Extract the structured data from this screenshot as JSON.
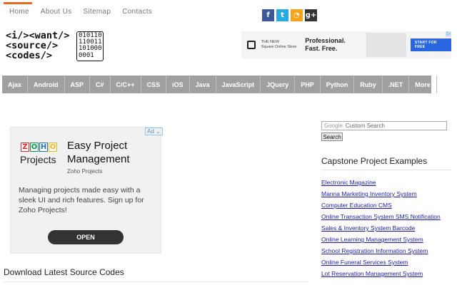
{
  "top_nav": {
    "items": [
      "Home",
      "About Us",
      "Sitemap",
      "Contacts"
    ]
  },
  "social": [
    {
      "icon": "facebook-icon",
      "glyph": "f",
      "color": "#3b5998"
    },
    {
      "icon": "twitter-icon",
      "glyph": "t",
      "color": "#29a9e1"
    },
    {
      "icon": "rss-icon",
      "glyph": "◔",
      "color": "#f7a21b"
    },
    {
      "icon": "google-plus-icon",
      "glyph": "g+",
      "color": "#333333"
    }
  ],
  "logo": {
    "line1": "<i/><want/>",
    "line2": "<source/>",
    "line3": "<codes/>",
    "binary": "010110\n110011\n101000\n0001"
  },
  "banner_ad": {
    "store": "THE NEW\nSquare Online Store",
    "slogan": "Professional.\nFast. Free.",
    "cta": "START FOR FREE"
  },
  "main_nav": {
    "items": [
      "Ajax",
      "Android",
      "ASP",
      "C#",
      "C/C++",
      "CSS",
      "iOS",
      "Java",
      "JavaScript",
      "JQuery",
      "PHP",
      "Python",
      "Ruby",
      ".NET",
      "More"
    ]
  },
  "side_ad": {
    "badge": "Ad",
    "brand_letters": [
      "Z",
      "O",
      "H",
      "O"
    ],
    "brand_subtitle": "Projects",
    "title": "Easy Project Management",
    "source": "Zoho Projects",
    "body": "Managing projects made easy with a sleek UI and rich features. Sign up for Zoho Projects!",
    "button": "OPEN"
  },
  "latest": {
    "heading": "Download Latest Source Codes"
  },
  "search": {
    "brand": "Google",
    "placeholder": "Custom Search",
    "button": "Search"
  },
  "sidebar": {
    "title": "Capstone Project Examples",
    "links": [
      "Electronic Magazine",
      "Manna Marketing Inventory System",
      "Computer Education CMS",
      "Online Transaction System SMS Notification",
      "Sales & Inventory System Barcode",
      "Online Learning Management System",
      "School Registration Information System",
      "Online Funeral Services System",
      "Lot Reservation Management System"
    ]
  },
  "colors": {
    "accent": "#e86b1c",
    "nav_bg": "#a0a0a0",
    "link": "#1a1aa6"
  }
}
